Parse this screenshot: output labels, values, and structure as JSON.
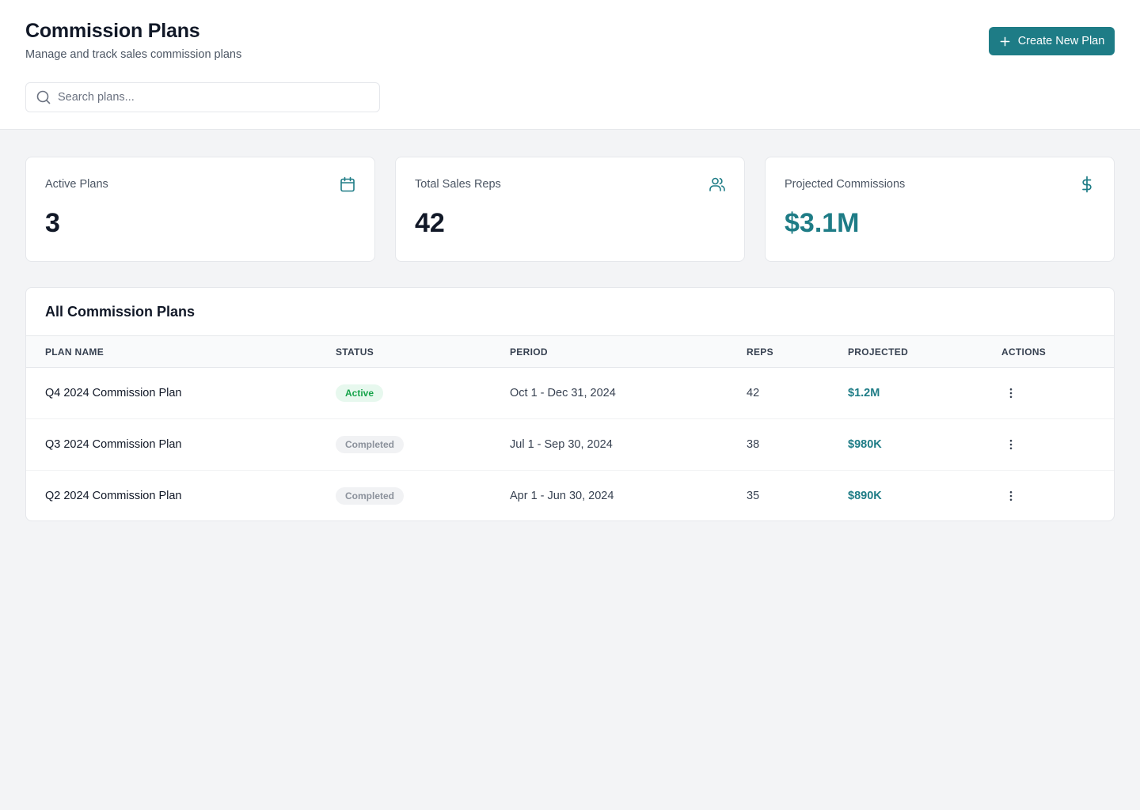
{
  "header": {
    "title": "Commission Plans",
    "subtitle": "Manage and track sales commission plans",
    "create_button": "Create New Plan",
    "search_placeholder": "Search plans..."
  },
  "stats": [
    {
      "label": "Active Plans",
      "value": "3",
      "icon": "calendar-icon"
    },
    {
      "label": "Total Sales Reps",
      "value": "42",
      "icon": "users-icon"
    },
    {
      "label": "Projected Commissions",
      "value": "$3.1M",
      "icon": "dollar-icon"
    }
  ],
  "table": {
    "title": "All Commission Plans",
    "columns": [
      "PLAN NAME",
      "STATUS",
      "PERIOD",
      "REPS",
      "PROJECTED",
      "ACTIONS"
    ],
    "rows": [
      {
        "name": "Q4 2024 Commission Plan",
        "status": "Active",
        "period": "Oct 1 - Dec 31, 2024",
        "reps": "42",
        "projected": "$1.2M"
      },
      {
        "name": "Q3 2024 Commission Plan",
        "status": "Completed",
        "period": "Jul 1 - Sep 30, 2024",
        "reps": "38",
        "projected": "$980K"
      },
      {
        "name": "Q2 2024 Commission Plan",
        "status": "Completed",
        "period": "Apr 1 - Jun 30, 2024",
        "reps": "35",
        "projected": "$890K"
      }
    ]
  },
  "colors": {
    "accent": "#1e7c86",
    "active_badge_bg": "#e7f8ee",
    "active_badge_text": "#16a34a",
    "completed_badge_bg": "#f1f2f4",
    "completed_badge_text": "#8b919b",
    "page_background": "#f3f4f6"
  }
}
